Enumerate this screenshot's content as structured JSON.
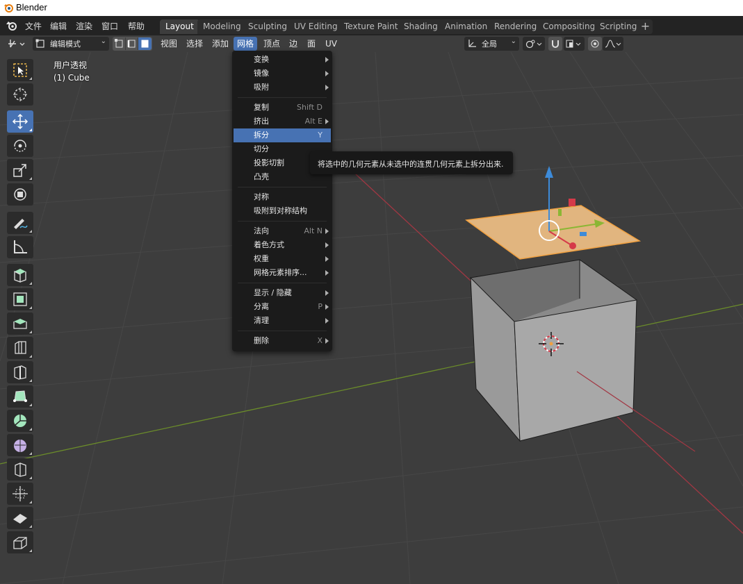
{
  "window": {
    "title": "Blender"
  },
  "main_menu": [
    "文件",
    "编辑",
    "渲染",
    "窗口",
    "帮助"
  ],
  "workspaces": [
    "Layout",
    "Modeling",
    "Sculpting",
    "UV Editing",
    "Texture Paint",
    "Shading",
    "Animation",
    "Rendering",
    "Compositing",
    "Scripting"
  ],
  "active_workspace": "Layout",
  "workspace_add": "+",
  "header": {
    "mode": "编辑模式",
    "menus": [
      "视图",
      "选择",
      "添加",
      "网格",
      "顶点",
      "边",
      "面",
      "UV"
    ],
    "active_menu": "网格",
    "transform_orientation": "全局"
  },
  "viewport": {
    "view_name": "用户透视",
    "object_info": "(1) Cube"
  },
  "toolbar": {
    "tools": [
      "select-box",
      "cursor",
      "move",
      "rotate",
      "scale",
      "transform",
      "annotate",
      "measure",
      "add-cube",
      "extrude-region",
      "inset-faces",
      "bevel",
      "loop-cut",
      "knife",
      "poly-build",
      "spin",
      "smooth",
      "edge-slide",
      "shrink-fatten",
      "shear",
      "rip-region"
    ],
    "active_tool": "move"
  },
  "mesh_menu": {
    "groups": [
      [
        {
          "label": "变换",
          "shortcut": "",
          "submenu": true
        },
        {
          "label": "镜像",
          "shortcut": "",
          "submenu": true
        },
        {
          "label": "吸附",
          "shortcut": "",
          "submenu": true
        }
      ],
      [
        {
          "label": "复制",
          "shortcut": "Shift D",
          "submenu": false
        },
        {
          "label": "挤出",
          "shortcut": "Alt E",
          "submenu": true
        },
        {
          "label": "拆分",
          "shortcut": "Y",
          "submenu": false,
          "highlighted": true
        },
        {
          "label": "切分",
          "shortcut": "",
          "submenu": false
        },
        {
          "label": "投影切割",
          "shortcut": "",
          "submenu": false
        },
        {
          "label": "凸壳",
          "shortcut": "",
          "submenu": false
        }
      ],
      [
        {
          "label": "对称",
          "shortcut": "",
          "submenu": false
        },
        {
          "label": "吸附到对称结构",
          "shortcut": "",
          "submenu": false
        }
      ],
      [
        {
          "label": "法向",
          "shortcut": "Alt N",
          "submenu": true
        },
        {
          "label": "着色方式",
          "shortcut": "",
          "submenu": true
        },
        {
          "label": "权重",
          "shortcut": "",
          "submenu": true
        },
        {
          "label": "网格元素排序...",
          "shortcut": "",
          "submenu": true
        }
      ],
      [
        {
          "label": "显示 / 隐藏",
          "shortcut": "",
          "submenu": true
        },
        {
          "label": "分离",
          "shortcut": "P",
          "submenu": true
        },
        {
          "label": "清理",
          "shortcut": "",
          "submenu": true
        }
      ],
      [
        {
          "label": "删除",
          "shortcut": "X",
          "submenu": true
        }
      ]
    ]
  },
  "tooltip": {
    "text": "将选中的几何元素从未选中的连贯几何元素上拆分出来."
  },
  "colors": {
    "accent": "#4772b3",
    "x_axis": "#d53a49",
    "y_axis": "#8bb634",
    "z_axis": "#3d8bd9",
    "selected_face": "#e6b378"
  }
}
